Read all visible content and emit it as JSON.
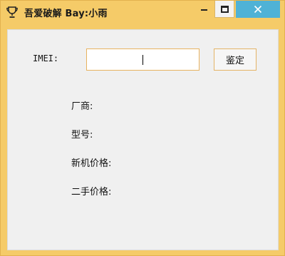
{
  "window": {
    "title": "吾爱破解    Bay:小雨"
  },
  "form": {
    "imei_label": "IMEI:",
    "imei_value": "",
    "verify_label": "鉴定"
  },
  "info": {
    "vendor_label": "厂商:",
    "model_label": "型号:",
    "new_price_label": "新机价格:",
    "used_price_label": "二手价格:"
  },
  "colors": {
    "frame": "#f5cb68",
    "close_button": "#4fb2d6",
    "input_border": "#e7b25f",
    "client_bg": "#f0f0f0"
  },
  "icons": {
    "app": "trophy-icon",
    "minimize": "minimize-icon",
    "maximize": "maximize-icon",
    "close": "close-icon"
  }
}
